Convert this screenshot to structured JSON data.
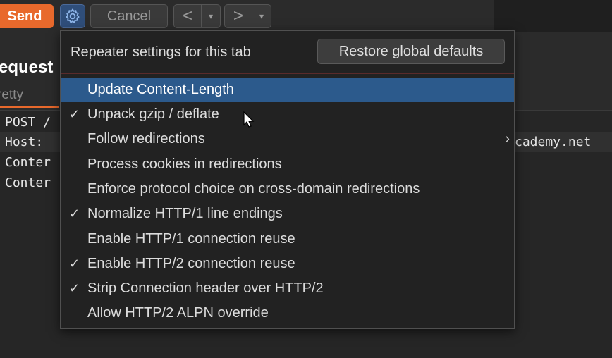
{
  "toolbar": {
    "send_label": "Send",
    "settings_icon": "gear-icon",
    "cancel_label": "Cancel",
    "back_label": "<",
    "forward_label": ">",
    "dropdown_glyph": "▾"
  },
  "panel": {
    "title": "equest",
    "tab_label": "retty"
  },
  "editor": {
    "lines": [
      "POST /",
      "Host:",
      "Conter",
      "Conter"
    ],
    "host_suffix": "cademy.net"
  },
  "popup": {
    "title": "Repeater settings for this tab",
    "restore_label": "Restore global defaults",
    "items": [
      {
        "label": "Update Content-Length",
        "checked": false,
        "selected": true
      },
      {
        "label": "Unpack gzip / deflate",
        "checked": true,
        "selected": false
      },
      {
        "label": "Follow redirections",
        "checked": false,
        "selected": false,
        "submenu": true
      },
      {
        "label": "Process cookies in redirections",
        "checked": false,
        "selected": false
      },
      {
        "label": "Enforce protocol choice on cross-domain redirections",
        "checked": false,
        "selected": false
      },
      {
        "label": "Normalize HTTP/1 line endings",
        "checked": true,
        "selected": false
      },
      {
        "label": "Enable HTTP/1 connection reuse",
        "checked": false,
        "selected": false
      },
      {
        "label": "Enable HTTP/2 connection reuse",
        "checked": true,
        "selected": false
      },
      {
        "label": "Strip Connection header over HTTP/2",
        "checked": true,
        "selected": false
      },
      {
        "label": "Allow HTTP/2 ALPN override",
        "checked": false,
        "selected": false
      }
    ],
    "check_glyph": "✓",
    "submenu_glyph": "›"
  }
}
